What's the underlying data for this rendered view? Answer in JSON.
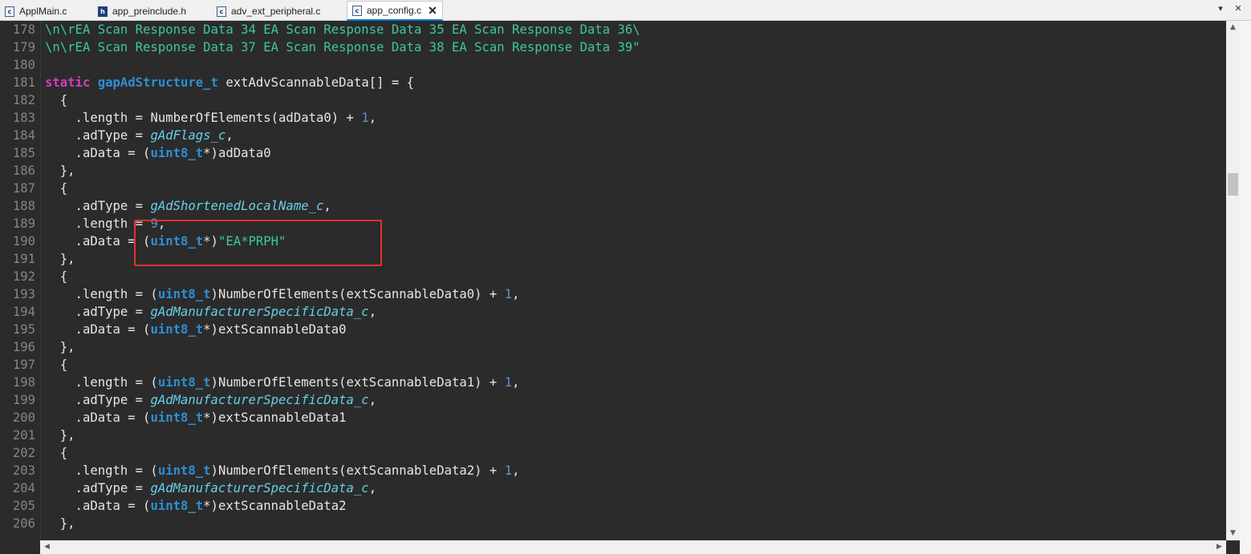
{
  "tabs": [
    {
      "label": "ApplMain.c",
      "icon": "c-file-icon"
    },
    {
      "label": "app_preinclude.h",
      "icon": "h-file-icon"
    },
    {
      "label": "adv_ext_peripheral.c",
      "icon": "c-file-icon"
    },
    {
      "label": "app_config.c",
      "icon": "c-file-icon",
      "active": true
    }
  ],
  "tab_close_glyph": "✕",
  "tab_controls": {
    "dropdown": "▾",
    "close": "✕"
  },
  "line_numbers": [
    "178",
    "179",
    "180",
    "181",
    "182",
    "183",
    "184",
    "185",
    "186",
    "187",
    "188",
    "189",
    "190",
    "191",
    "192",
    "193",
    "194",
    "195",
    "196",
    "197",
    "198",
    "199",
    "200",
    "201",
    "202",
    "203",
    "204",
    "205",
    "206"
  ],
  "code": {
    "l178": "\\n\\rEA Scan Response Data 34 EA Scan Response Data 35 EA Scan Response Data 36\\",
    "l179": "\\n\\rEA Scan Response Data 37 EA Scan Response Data 38 EA Scan Response Data 39\"",
    "kw_static": "static",
    "ty_struct": "gapAdStructure_t",
    "l181_rest": " extAdvScannableData[] = {",
    "brace_open": "  {",
    "brace_close": "  },",
    "length_prefix": "    .length = ",
    "adtype_prefix": "    .adType = ",
    "adata_prefix": "    .aData = (",
    "cast_type": "uint8_t",
    "cast_close": "*)",
    "noe_adData0": "NumberOfElements(adData0) + ",
    "num_1": "1",
    "comma": ",",
    "gAdFlags": "gAdFlags_c",
    "adData0": "adData0",
    "gAdShortName": "gAdShortenedLocalName_c",
    "num_9": "9",
    "str_name": "\"EA*PRPH\"",
    "len_cast_open": "    .length = (",
    "cast_close_paren": ")",
    "noe_ext0": "NumberOfElements(extScannableData0) + ",
    "noe_ext1": "NumberOfElements(extScannableData1) + ",
    "noe_ext2": "NumberOfElements(extScannableData2) + ",
    "gAdMfg": "gAdManufacturerSpecificData_c",
    "ext0": "extScannableData0",
    "ext1": "extScannableData1",
    "ext2": "extScannableData2"
  },
  "scroll": {
    "up": "▲",
    "down": "▼",
    "left": "◀",
    "right": "▶"
  },
  "colors": {
    "keyword": "#d63fb8",
    "type": "#2d8fd4",
    "string": "#3ec6a4",
    "enum": "#66cfe8",
    "highlight_box": "#e8302a"
  }
}
